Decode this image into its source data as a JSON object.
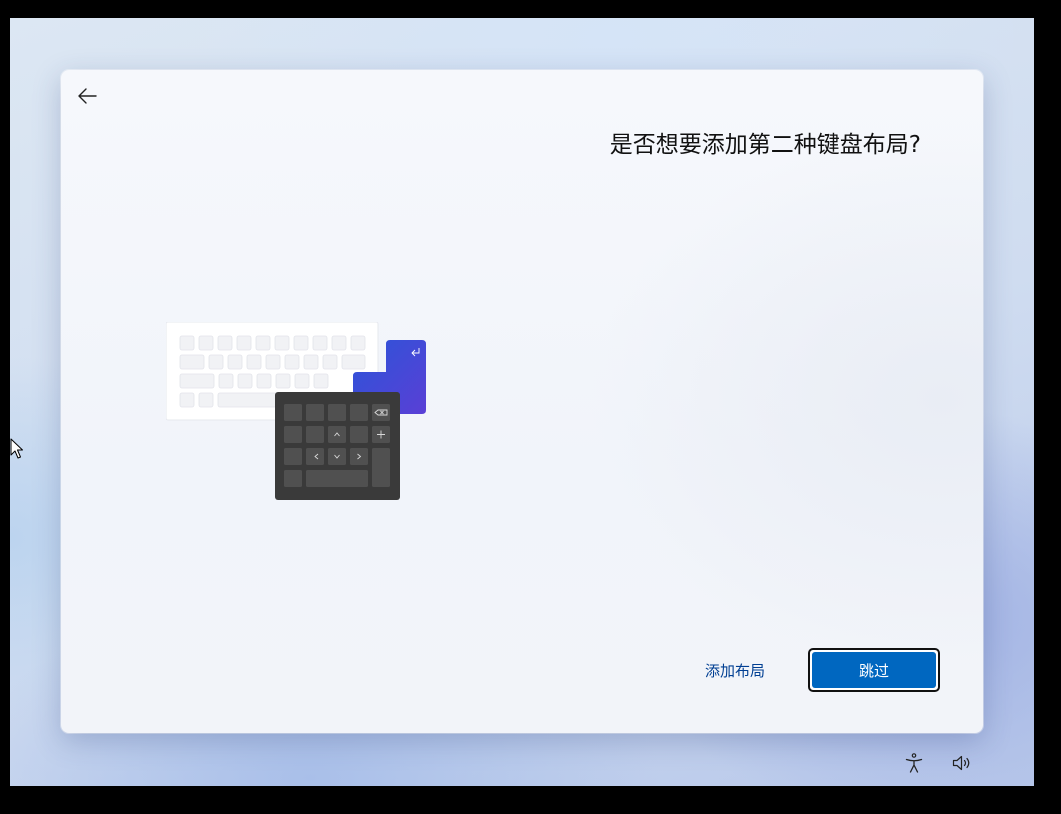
{
  "dialog": {
    "title": "是否想要添加第二种键盘布局?",
    "back_icon": "arrow-left-icon",
    "add_layout_label": "添加布局",
    "skip_label": "跳过"
  },
  "taskbar": {
    "accessibility_icon": "accessibility-icon",
    "volume_icon": "volume-icon"
  },
  "colors": {
    "primary_button": "#0067c0",
    "link": "#003e92",
    "numpad": "#3a3a3a",
    "accent_key_start": "#2b55d8",
    "accent_key_end": "#5a3fd6"
  }
}
